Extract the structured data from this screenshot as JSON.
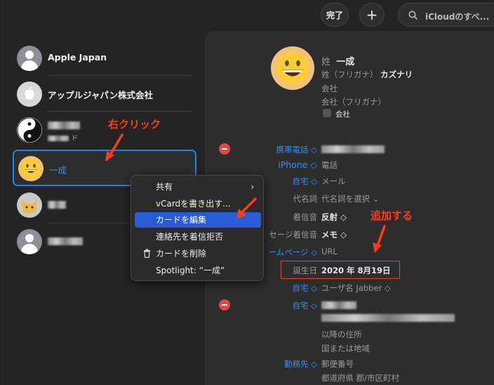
{
  "toolbar": {
    "done_label": "完了",
    "add_label": "+",
    "search_placeholder": "iCloudのすべ..."
  },
  "contacts": [
    {
      "name": "Apple Japan"
    },
    {
      "name": "アップルジャパン株式会社"
    },
    {
      "name": "",
      "sub": "ド"
    },
    {
      "name": "一成"
    },
    {
      "name": ""
    },
    {
      "name": ""
    }
  ],
  "context_menu": {
    "items": [
      {
        "label": "共有"
      },
      {
        "label": "vCardを書き出す..."
      },
      {
        "label": "カードを編集"
      },
      {
        "label": "連絡先を着信拒否"
      },
      {
        "label": "カードを削除"
      },
      {
        "label": "Spotlight: “一成”"
      }
    ]
  },
  "detail": {
    "last_name_label": "姓",
    "last_name_value": "一成",
    "furigana_label": "姓（フリガナ）",
    "furigana_value": "カズナリ",
    "company_label": "会社",
    "company_furigana_label": "会社（フリガナ）",
    "company_checkbox_label": "会社",
    "fields": [
      {
        "label": "携帯電話 ◇",
        "value": ""
      },
      {
        "label": "iPhone ◇",
        "value": "電話"
      },
      {
        "label": "自宅 ◇",
        "value": "メール"
      },
      {
        "label": "代名詞",
        "value": "代名詞を選択 ⌄"
      },
      {
        "label": "着信音",
        "value": "反射 ◇"
      },
      {
        "label": "セージ着信音",
        "value": "メモ ◇"
      },
      {
        "label": "ームページ ◇",
        "value": "URL"
      },
      {
        "label": "誕生日",
        "value": "2020 年 8月19日"
      },
      {
        "label": "自宅 ◇",
        "value": "ユーザ名  Jabber ◇"
      },
      {
        "label": "自宅 ◇",
        "value": ""
      },
      {
        "label": "",
        "value": "以降の住所"
      },
      {
        "label": "",
        "value": "国または地域"
      },
      {
        "label": "勤務先 ◇",
        "value": "郵便番号"
      },
      {
        "label": "",
        "value": "都道府県  郡/市区町村"
      }
    ]
  },
  "annotations": {
    "right_click": "右クリック",
    "add": "追加する"
  },
  "colors": {
    "accent": "#2a5bd7",
    "annotation": "#ff3b1e",
    "link_blue": "#3d8bf0"
  }
}
